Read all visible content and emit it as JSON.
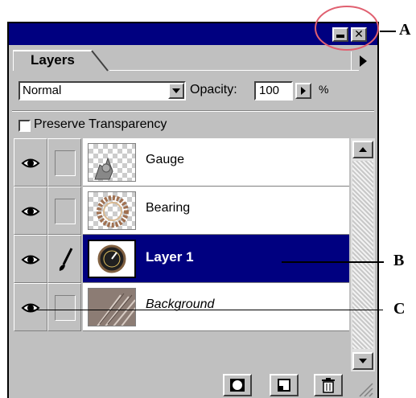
{
  "panel": {
    "tab_label": "Layers",
    "blend_mode": "Normal",
    "opacity_label": "Opacity:",
    "opacity_value": "100",
    "percent_label": "%",
    "preserve_label": "Preserve Transparency",
    "preserve_checked": false
  },
  "layers": [
    {
      "name": "Gauge",
      "visible": true,
      "brush": false,
      "selected": false,
      "italic": false
    },
    {
      "name": "Bearing",
      "visible": true,
      "brush": false,
      "selected": false,
      "italic": false
    },
    {
      "name": "Layer 1",
      "visible": true,
      "brush": true,
      "selected": true,
      "italic": false
    },
    {
      "name": "Background",
      "visible": true,
      "brush": false,
      "selected": false,
      "italic": true
    }
  ],
  "callouts": {
    "a": "A",
    "b": "B",
    "c": "C"
  },
  "colors": {
    "titlebar": "#000080",
    "selection": "#000080",
    "panel_bg": "#c0c0c0",
    "callout_circle": "#e06070"
  },
  "icons": {
    "minimize": "minimize-icon",
    "close": "close-icon",
    "menu": "panel-menu-arrow-icon",
    "eye": "eye-icon",
    "brush": "paintbrush-icon",
    "mask": "layer-mask-icon",
    "new_layer": "new-layer-icon",
    "trash": "trash-icon"
  }
}
